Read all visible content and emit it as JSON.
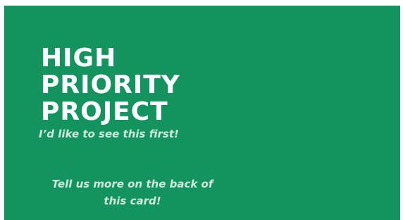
{
  "card": {
    "title_lines": [
      "HIGH",
      "PRIORITY",
      "PROJECT"
    ],
    "subtitle": "I’d like to see this first!",
    "footer_lines": [
      "Tell us more on the back of",
      "this card!"
    ],
    "background_color": "#13945f",
    "title_color": "#ffffff",
    "text_color": "#cfe9dc"
  }
}
